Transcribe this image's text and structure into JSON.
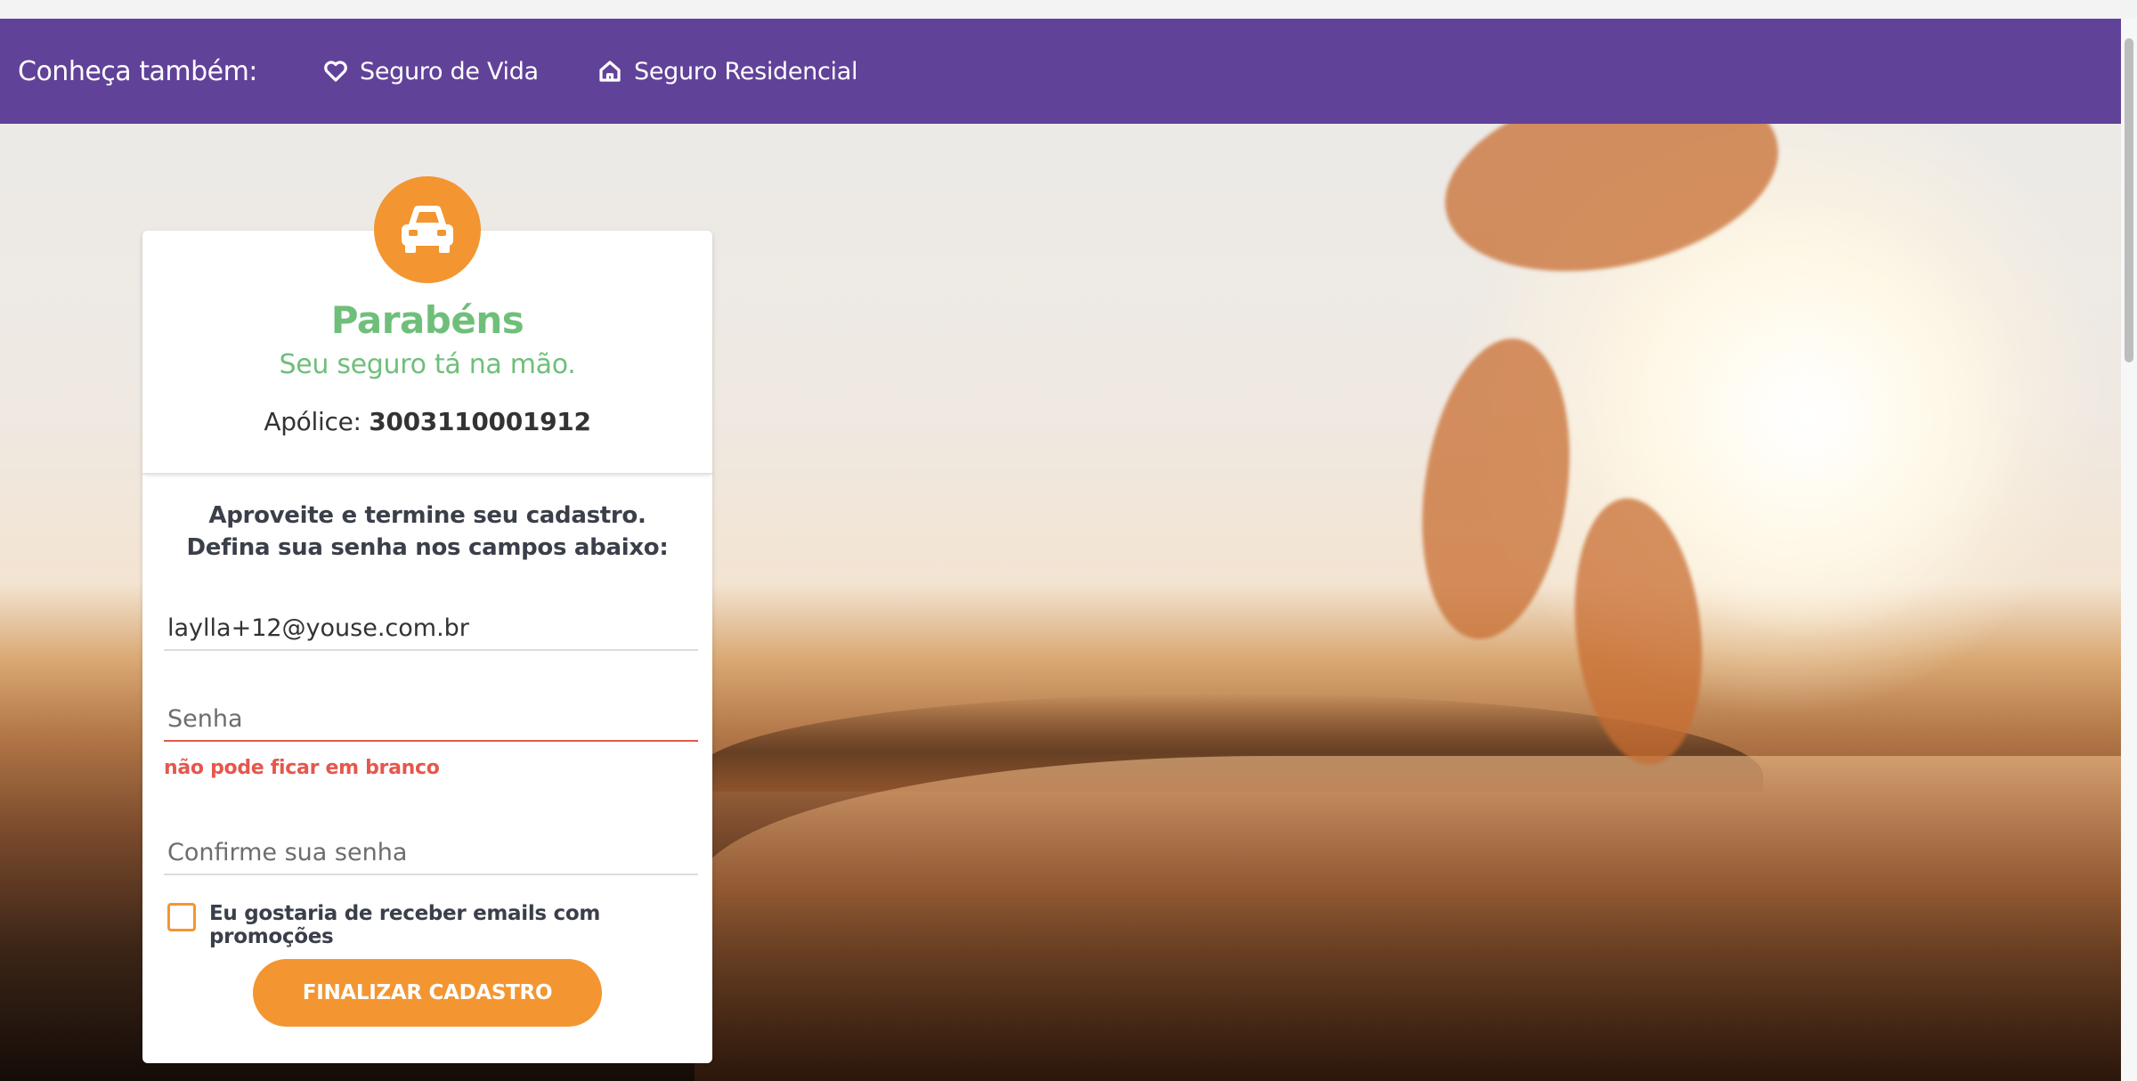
{
  "topbar": {
    "label": "Conheça também:",
    "links": [
      {
        "label": "Seguro de Vida",
        "icon": "heart-icon"
      },
      {
        "label": "Seguro Residencial",
        "icon": "home-icon"
      }
    ]
  },
  "card": {
    "badge_icon": "car-icon",
    "title": "Parabéns",
    "subtitle": "Seu seguro tá na mão.",
    "apolice_label": "Apólice:",
    "apolice_number": "3003110001912",
    "intro_line1": "Aproveite e termine seu cadastro.",
    "intro_line2": "Defina sua senha nos campos abaixo:",
    "email_value": "laylla+12@youse.com.br",
    "senha_placeholder": "Senha",
    "senha_error": "não pode ficar em branco",
    "confirm_placeholder": "Confirme sua senha",
    "checkbox_label": "Eu gostaria de receber emails com promoções",
    "submit_label": "FINALIZAR CADASTRO"
  },
  "colors": {
    "topbar": "#614299",
    "accent": "#f39632",
    "success": "#6fbf7a",
    "error": "#e5574d"
  }
}
